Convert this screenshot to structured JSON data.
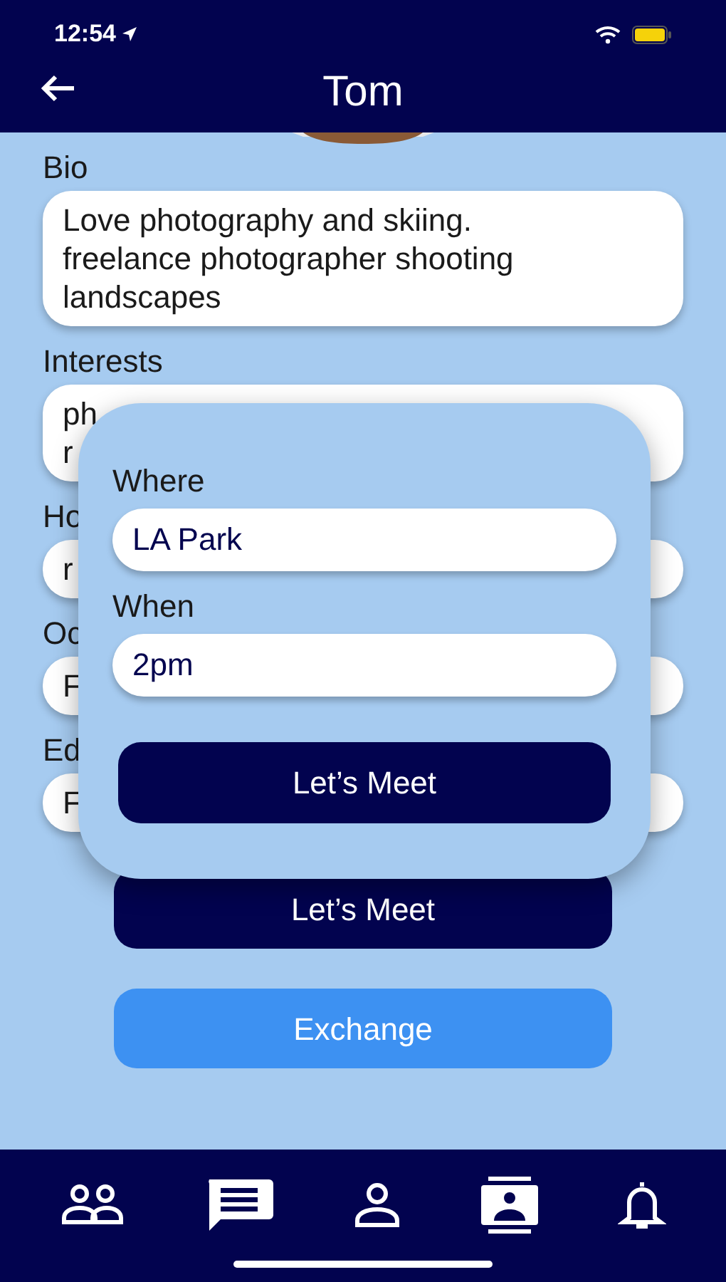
{
  "status_bar": {
    "time": "12:54"
  },
  "header": {
    "title": "Tom"
  },
  "profile_fields": [
    {
      "label": "Bio",
      "lines": [
        "Love photography and skiing.",
        "freelance photographer shooting",
        "landscapes"
      ]
    },
    {
      "label": "Interests",
      "lines": [
        "ph",
        "r"
      ]
    },
    {
      "label": "Ho",
      "lines": [
        "r"
      ]
    },
    {
      "label": "Oc",
      "lines": [
        "F"
      ]
    },
    {
      "label": "Ed",
      "lines": [
        "F"
      ]
    }
  ],
  "buttons": [
    {
      "label": "Let’s Meet",
      "kind": "primary"
    },
    {
      "label": "Exchange",
      "kind": "secondary"
    }
  ],
  "meet_popup": {
    "fields": [
      {
        "label": "Where",
        "value": "LA Park"
      },
      {
        "label": "When",
        "value": "2pm"
      }
    ],
    "button": "Let’s Meet"
  }
}
